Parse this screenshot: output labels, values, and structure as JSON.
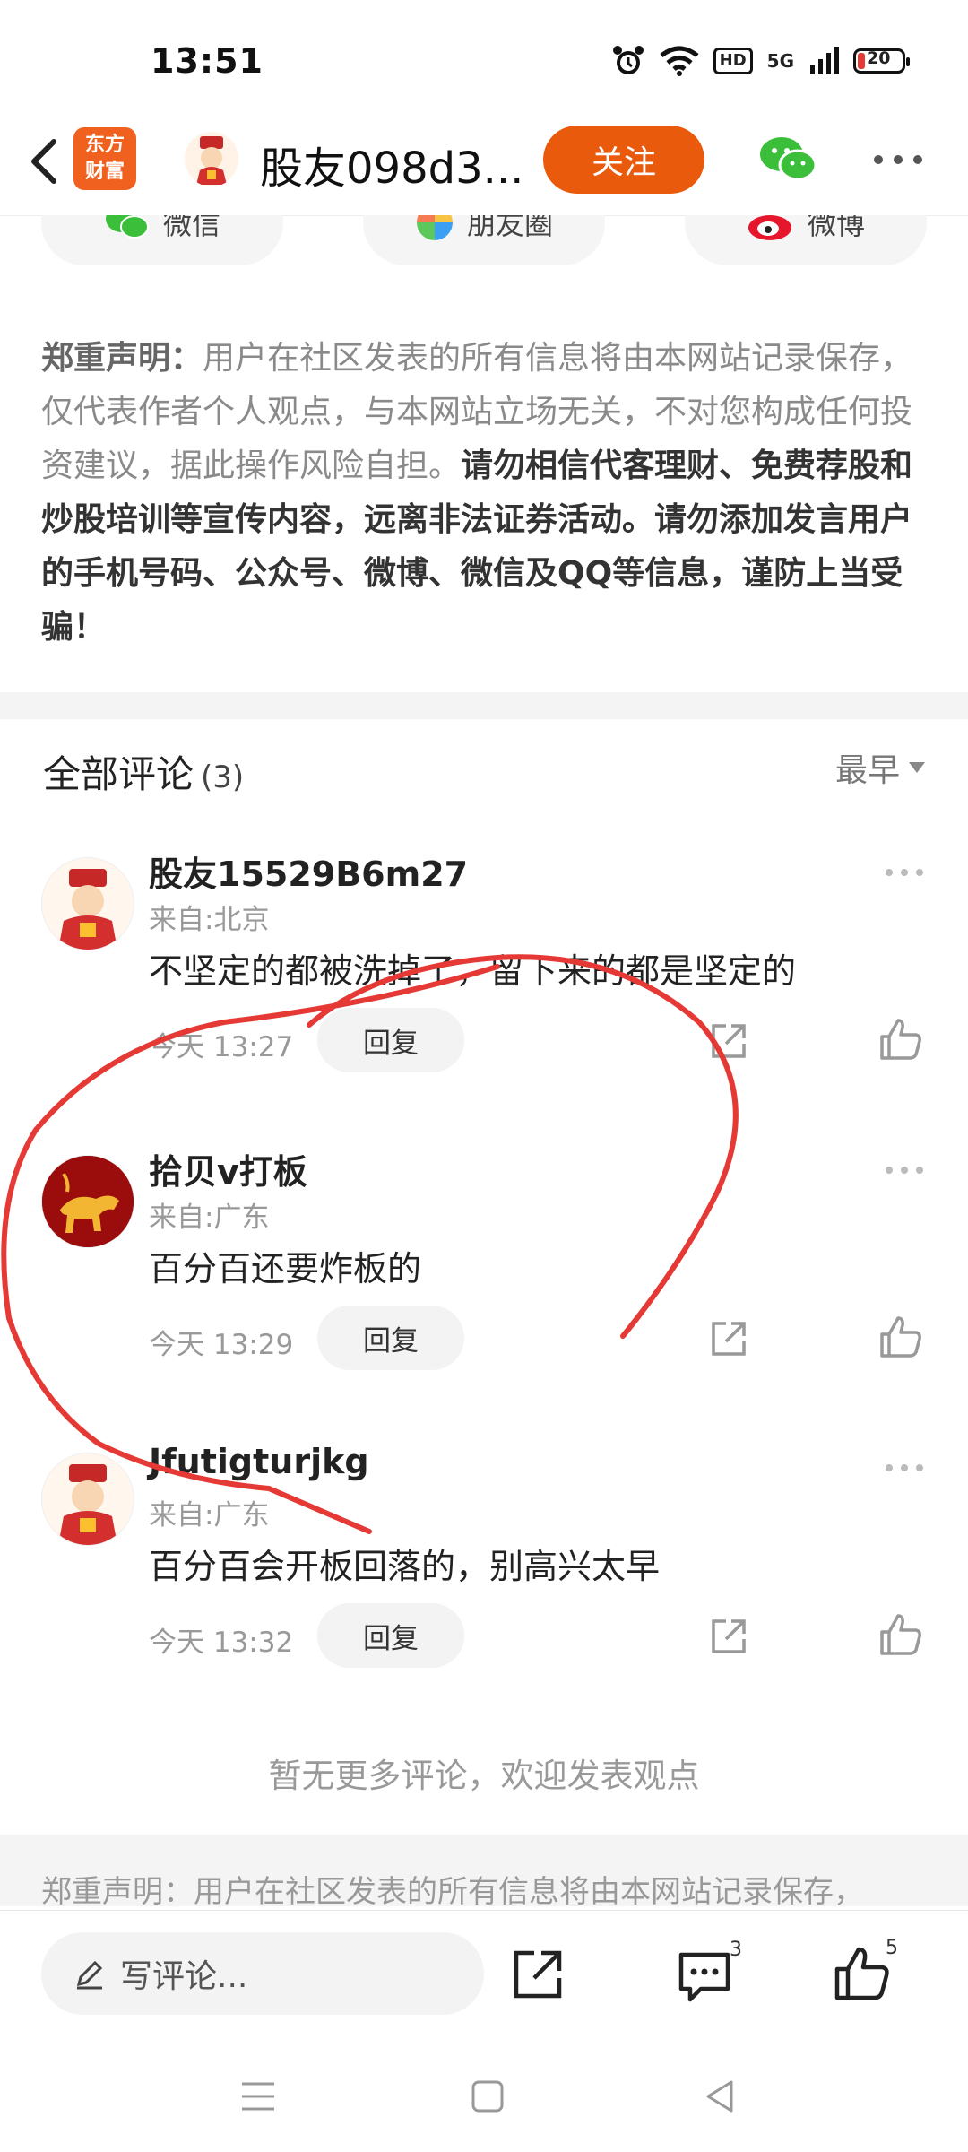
{
  "status_bar": {
    "time": "13:51",
    "hd": "HD",
    "network": "5G",
    "battery": "20"
  },
  "nav": {
    "logo_line1": "东方",
    "logo_line2": "财富",
    "title": "股友098d3...",
    "follow_label": "关注"
  },
  "share": {
    "items": [
      {
        "label": "微信"
      },
      {
        "label": "朋友圈"
      },
      {
        "label": "微博"
      }
    ]
  },
  "disclaimer": {
    "prefix": "郑重声明：",
    "normal": "用户在社区发表的所有信息将由本网站记录保存，仅代表作者个人观点，与本网站立场无关，不对您构成任何投资建议，据此操作风险自担。",
    "bold": "请勿相信代客理财、免费荐股和炒股培训等宣传内容，远离非法证券活动。请勿添加发言用户的手机号码、公众号、微博、微信及QQ等信息，谨防上当受骗！"
  },
  "comments": {
    "title": "全部评论",
    "count": "(3)",
    "sort_label": "最早",
    "reply_label": "回复",
    "items": [
      {
        "name": "股友15529B6m27",
        "location": "来自:北京",
        "text": "不坚定的都被洗掉了，留下来的都是坚定的",
        "time": "今天 13:27"
      },
      {
        "name": "拾贝v打板",
        "location": "来自:广东",
        "text": "百分百还要炸板的",
        "time": "今天 13:29"
      },
      {
        "name": "Jfutigturjkg",
        "location": "来自:广东",
        "text": "百分百会开板回落的，别高兴太早",
        "time": "今天 13:32"
      }
    ],
    "no_more": "暂无更多评论，欢迎发表观点"
  },
  "footer_disclaimer": "郑重声明：用户在社区发表的所有信息将由本网站记录保存，",
  "bottom_bar": {
    "input_placeholder": "写评论...",
    "comment_count": "3",
    "like_count": "5"
  },
  "colors": {
    "accent": "#ea5a0c",
    "annotation": "#e53935",
    "wechat_green": "#3bbf3b"
  }
}
